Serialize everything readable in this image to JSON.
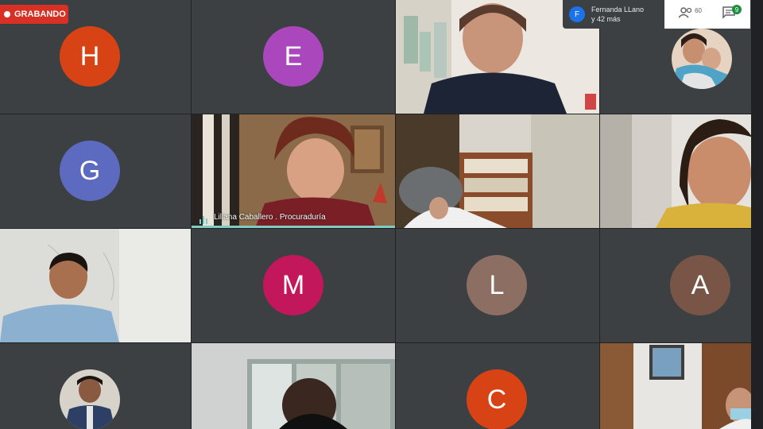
{
  "recording": {
    "label": "GRABANDO"
  },
  "presenter": {
    "initial": "F",
    "name": "Fernanda LLano",
    "others": "y 42 más"
  },
  "topbar": {
    "participants_count": "60",
    "chat_badge": "9"
  },
  "tiles": {
    "h": {
      "initial": "H",
      "color": "#d84315"
    },
    "e": {
      "initial": "E",
      "color": "#ab47bc"
    },
    "g": {
      "initial": "G",
      "color": "#5c6bc0"
    },
    "m": {
      "initial": "M",
      "color": "#c2185b"
    },
    "l": {
      "initial": "L",
      "color": "#8d6e63"
    },
    "a": {
      "initial": "A",
      "color": "#795548"
    },
    "c": {
      "initial": "C",
      "color": "#d84315"
    },
    "speaker": {
      "name": "Liliana Caballero . Procuraduría"
    }
  }
}
